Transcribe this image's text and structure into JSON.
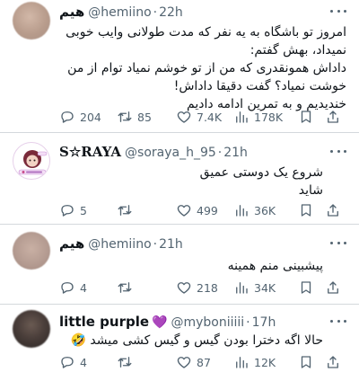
{
  "tweets": [
    {
      "name": "هیم",
      "handle": "@hemiino",
      "time": "22h",
      "lines": [
        "امروز تو باشگاه به یه نفر که مدت طولانی وایب خوبی",
        "نمیداد، بهش گفتم:",
        "داداش همونقدری که من از تو خوشم نمیاد توام از من",
        "خوشت نمیاد؟ گفت دقیقا داداش!",
        "خندیدیم و به تمرین ادامه دادیم"
      ],
      "replies": "204",
      "retweets": "85",
      "likes": "7.4K",
      "views": "178K"
    },
    {
      "name": "S☆RAYA",
      "handle": "@soraya_h_95",
      "time": "21h",
      "lines": [
        "شروع یک دوستی عمیق",
        "شاید"
      ],
      "replies": "5",
      "retweets": "",
      "likes": "499",
      "views": "36K"
    },
    {
      "name": "هیم",
      "handle": "@hemiino",
      "time": "21h",
      "lines": [
        "پیشبینی منم همینه"
      ],
      "replies": "4",
      "retweets": "",
      "likes": "218",
      "views": "34K"
    },
    {
      "name": "little purple",
      "name_emoji": "💜",
      "handle": "@myboniiiii",
      "time": "17h",
      "lines": [
        "حالا اگه دخترا بودن گیس و گیس کشی میشد 🤣"
      ],
      "replies": "4",
      "retweets": "",
      "likes": "87",
      "views": "12K"
    }
  ],
  "icons": {
    "reply": "reply-icon",
    "retweet": "retweet-icon",
    "like": "heart-icon",
    "views": "views-icon",
    "bookmark": "bookmark-icon",
    "share": "share-icon",
    "more": "more-icon"
  },
  "colors": {
    "text": "#0f1419",
    "secondary": "#536471",
    "separator": "#d4d8dc",
    "purple_heart": "#9b30ff"
  }
}
